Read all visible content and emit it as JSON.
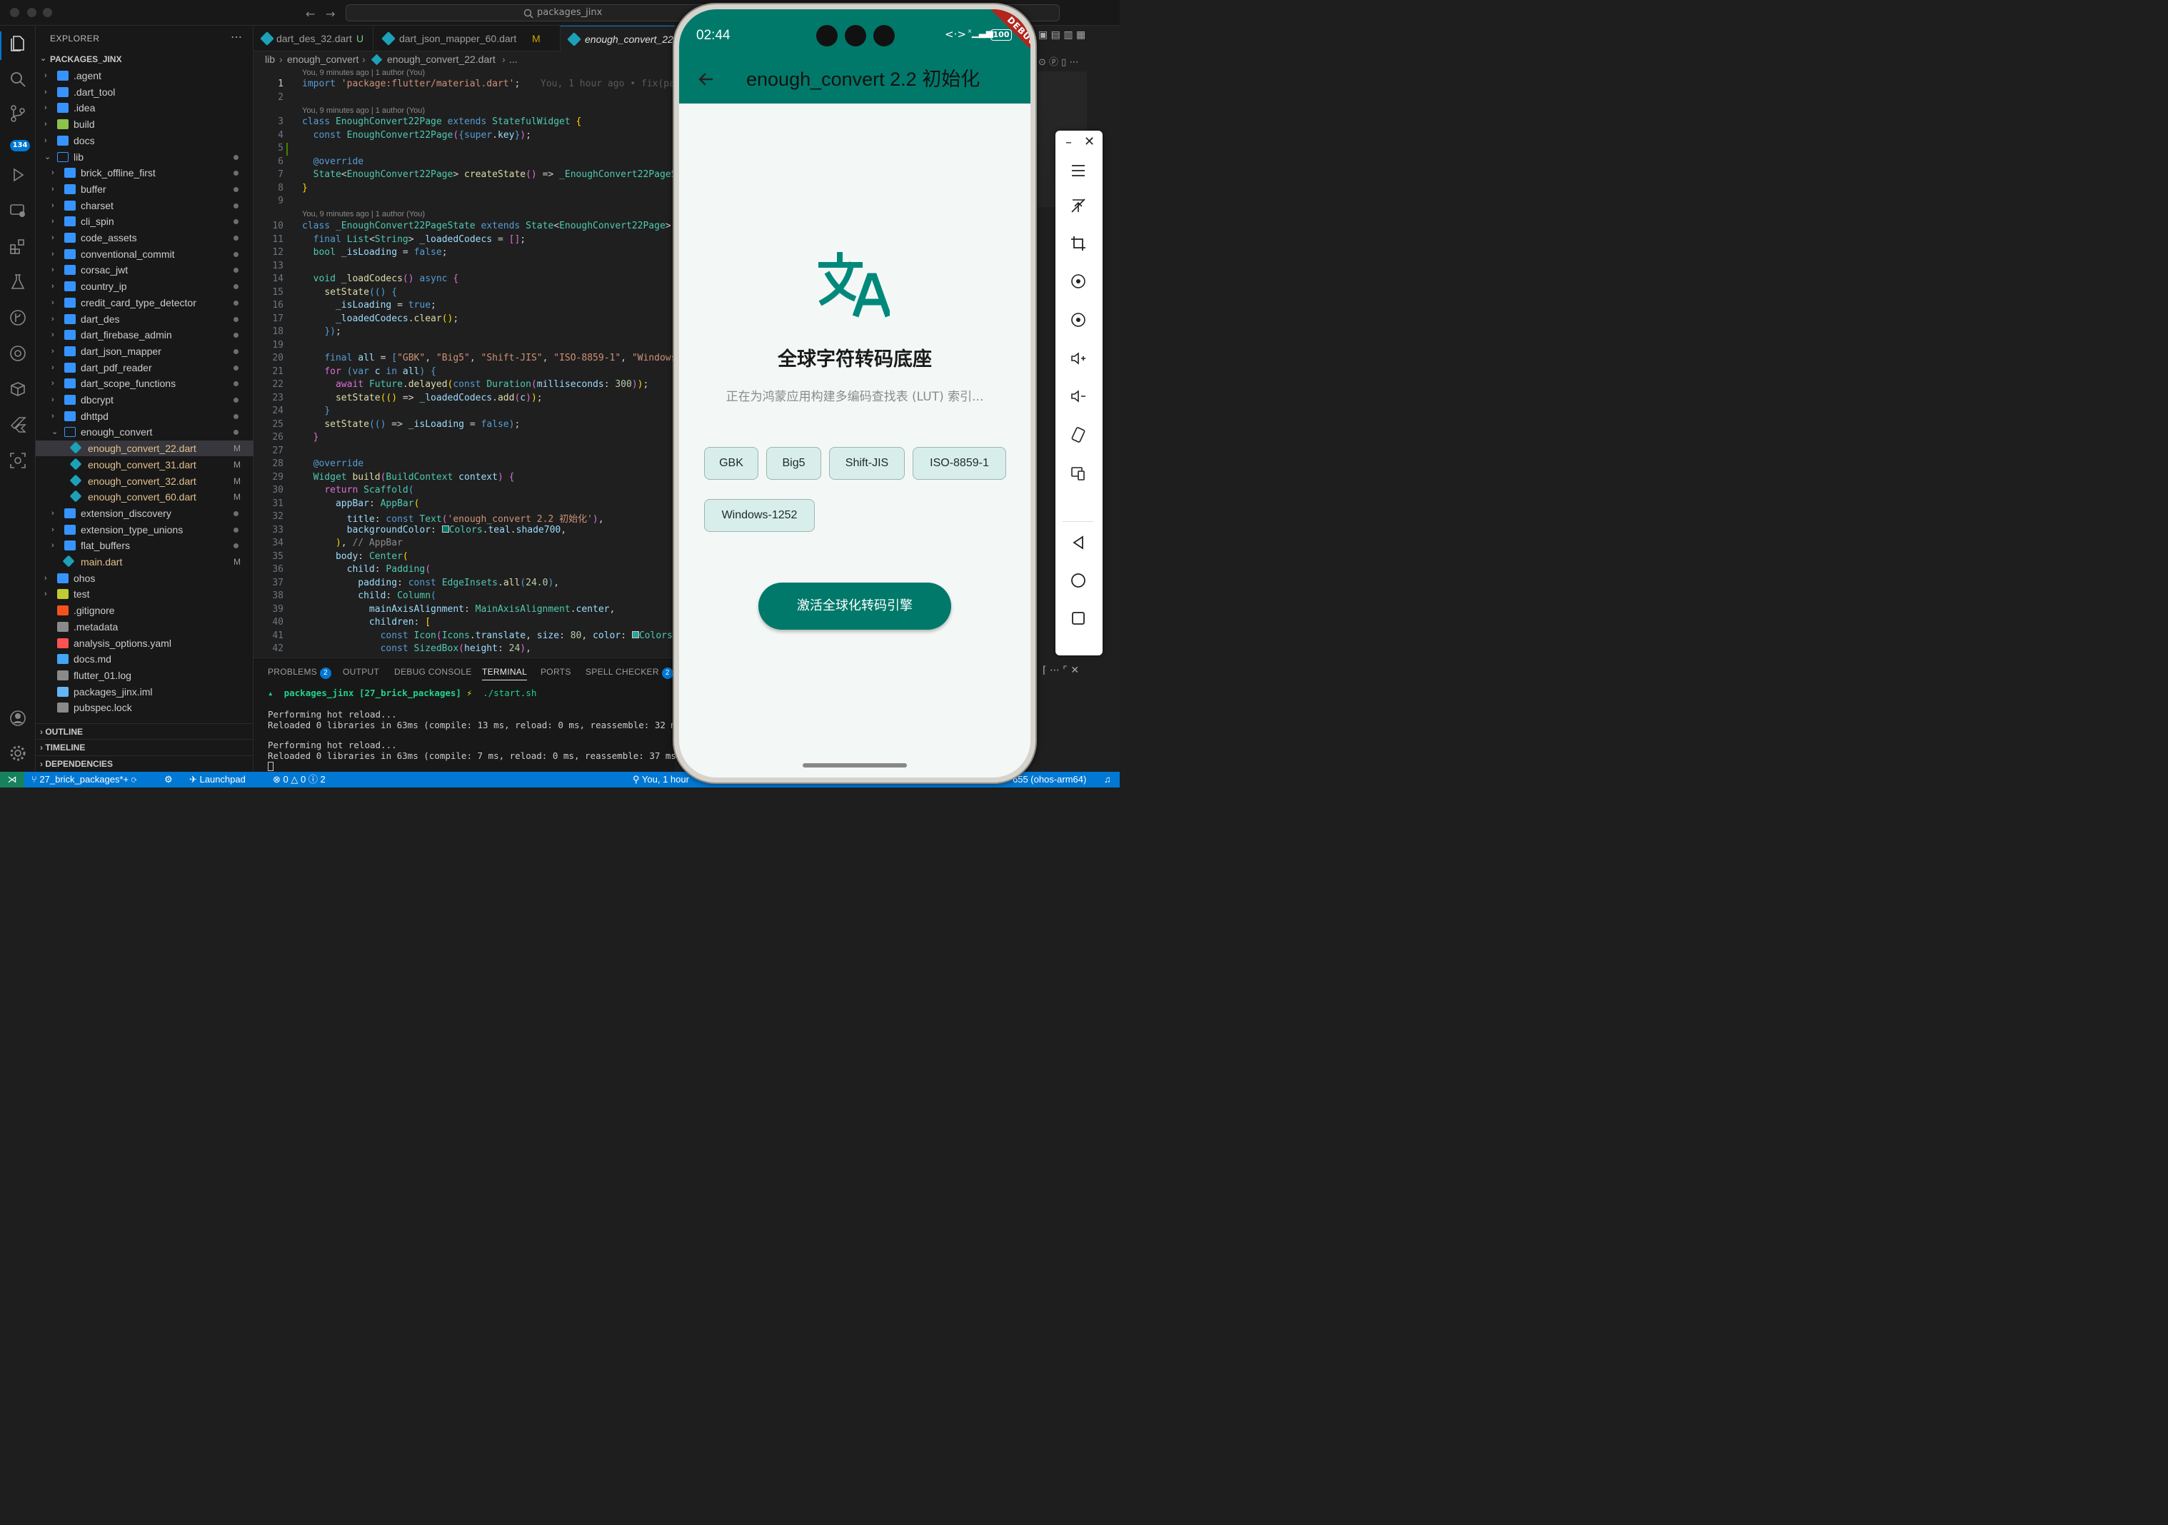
{
  "window": {
    "search": "packages_jinx"
  },
  "activity_badge": "134",
  "sidebar": {
    "header": "EXPLORER",
    "root": "PACKAGES_JINX",
    "tree": [
      {
        "label": ".agent",
        "depth": 1,
        "kind": "folder",
        "status": ""
      },
      {
        "label": ".dart_tool",
        "depth": 1,
        "kind": "folder",
        "status": ""
      },
      {
        "label": ".idea",
        "depth": 1,
        "kind": "folder",
        "status": ""
      },
      {
        "label": "build",
        "depth": 1,
        "kind": "folder-build",
        "status": ""
      },
      {
        "label": "docs",
        "depth": 1,
        "kind": "folder",
        "status": ""
      },
      {
        "label": "lib",
        "depth": 1,
        "kind": "folder-open",
        "status": "dot"
      },
      {
        "label": "brick_offline_first",
        "depth": 2,
        "kind": "folder",
        "status": "dot"
      },
      {
        "label": "buffer",
        "depth": 2,
        "kind": "folder",
        "status": "dot"
      },
      {
        "label": "charset",
        "depth": 2,
        "kind": "folder",
        "status": "dot"
      },
      {
        "label": "cli_spin",
        "depth": 2,
        "kind": "folder",
        "status": "dot"
      },
      {
        "label": "code_assets",
        "depth": 2,
        "kind": "folder",
        "status": "dot"
      },
      {
        "label": "conventional_commit",
        "depth": 2,
        "kind": "folder",
        "status": "dot"
      },
      {
        "label": "corsac_jwt",
        "depth": 2,
        "kind": "folder",
        "status": "dot"
      },
      {
        "label": "country_ip",
        "depth": 2,
        "kind": "folder",
        "status": "dot"
      },
      {
        "label": "credit_card_type_detector",
        "depth": 2,
        "kind": "folder",
        "status": "dot"
      },
      {
        "label": "dart_des",
        "depth": 2,
        "kind": "folder",
        "status": "dot"
      },
      {
        "label": "dart_firebase_admin",
        "depth": 2,
        "kind": "folder",
        "status": "dot"
      },
      {
        "label": "dart_json_mapper",
        "depth": 2,
        "kind": "folder",
        "status": "dot"
      },
      {
        "label": "dart_pdf_reader",
        "depth": 2,
        "kind": "folder",
        "status": "dot"
      },
      {
        "label": "dart_scope_functions",
        "depth": 2,
        "kind": "folder",
        "status": "dot"
      },
      {
        "label": "dbcrypt",
        "depth": 2,
        "kind": "folder",
        "status": "dot"
      },
      {
        "label": "dhttpd",
        "depth": 2,
        "kind": "folder",
        "status": "dot"
      },
      {
        "label": "enough_convert",
        "depth": 2,
        "kind": "folder-open",
        "status": "dot"
      },
      {
        "label": "enough_convert_22.dart",
        "depth": 3,
        "kind": "dart",
        "status": "M",
        "selected": true
      },
      {
        "label": "enough_convert_31.dart",
        "depth": 3,
        "kind": "dart",
        "status": "M"
      },
      {
        "label": "enough_convert_32.dart",
        "depth": 3,
        "kind": "dart",
        "status": "M"
      },
      {
        "label": "enough_convert_60.dart",
        "depth": 3,
        "kind": "dart",
        "status": "M"
      },
      {
        "label": "extension_discovery",
        "depth": 2,
        "kind": "folder",
        "status": "dot"
      },
      {
        "label": "extension_type_unions",
        "depth": 2,
        "kind": "folder",
        "status": "dot"
      },
      {
        "label": "flat_buffers",
        "depth": 2,
        "kind": "folder",
        "status": "dot"
      },
      {
        "label": "main.dart",
        "depth": 2,
        "kind": "dart",
        "status": "M"
      },
      {
        "label": "ohos",
        "depth": 1,
        "kind": "folder",
        "status": ""
      },
      {
        "label": "test",
        "depth": 1,
        "kind": "folder-test",
        "status": ""
      },
      {
        "label": ".gitignore",
        "depth": 1,
        "kind": "git",
        "status": ""
      },
      {
        "label": ".metadata",
        "depth": 1,
        "kind": "file",
        "status": ""
      },
      {
        "label": "analysis_options.yaml",
        "depth": 1,
        "kind": "yaml",
        "status": ""
      },
      {
        "label": "docs.md",
        "depth": 1,
        "kind": "md",
        "status": ""
      },
      {
        "label": "flutter_01.log",
        "depth": 1,
        "kind": "file",
        "status": ""
      },
      {
        "label": "packages_jinx.iml",
        "depth": 1,
        "kind": "xml",
        "status": ""
      },
      {
        "label": "pubspec.lock",
        "depth": 1,
        "kind": "file",
        "status": ""
      }
    ],
    "sections": [
      "OUTLINE",
      "TIMELINE",
      "DEPENDENCIES"
    ]
  },
  "tabs": [
    {
      "label": "dart_des_32.dart",
      "status": "U"
    },
    {
      "label": "dart_json_mapper_60.dart",
      "status": "M"
    },
    {
      "label": "enough_convert_22.dart",
      "status": ""
    }
  ],
  "breadcrumbs": {
    "part1": "lib",
    "part2": "enough_convert",
    "part3": "enough_convert_22.dart",
    "part4": "..."
  },
  "code": {
    "lens": "You, 9 minutes ago | 1 author (You)",
    "inline_blame": "You, 1 hour ago • fix(pac"
  },
  "panel": {
    "tabs": [
      {
        "label": "PROBLEMS",
        "badge": "2"
      },
      {
        "label": "OUTPUT",
        "badge": ""
      },
      {
        "label": "DEBUG CONSOLE",
        "badge": ""
      },
      {
        "label": "TERMINAL",
        "badge": ""
      },
      {
        "label": "PORTS",
        "badge": ""
      },
      {
        "label": "SPELL CHECKER",
        "badge": "2"
      }
    ],
    "prompt_dir": "packages_jinx",
    "prompt_branch": "[27_brick_packages]",
    "prompt_symbol": "⚡",
    "prompt_cmd": "./start.sh",
    "lines": [
      "Performing hot reload...",
      "Reloaded 0 libraries in 63ms (compile: 13 ms, reload: 0 ms, reassemble: 32 ms).",
      "Performing hot reload...",
      "Reloaded 0 libraries in 63ms (compile: 7 ms, reload: 0 ms, reassemble: 37 ms)."
    ]
  },
  "statusbar": {
    "branch": "27_brick_packages*+",
    "launchpad": "Launchpad",
    "errors": "0",
    "warnings": "0",
    "infos": "2",
    "blame": "You, 1 hour",
    "arch": "655 (ohos-arm64)"
  },
  "phone": {
    "time": "02:44",
    "battery": "100",
    "debug_banner": "DEBUG",
    "appbar_title": "enough_convert 2.2 初始化",
    "heading": "全球字符转码底座",
    "subtitle": "正在为鸿蒙应用构建多编码查找表 (LUT) 索引...",
    "codecs": [
      "GBK",
      "Big5",
      "Shift-JIS",
      "ISO-8859-1",
      "Windows-1252"
    ],
    "button": "激活全球化转码引擎",
    "accent": "#00796b"
  }
}
